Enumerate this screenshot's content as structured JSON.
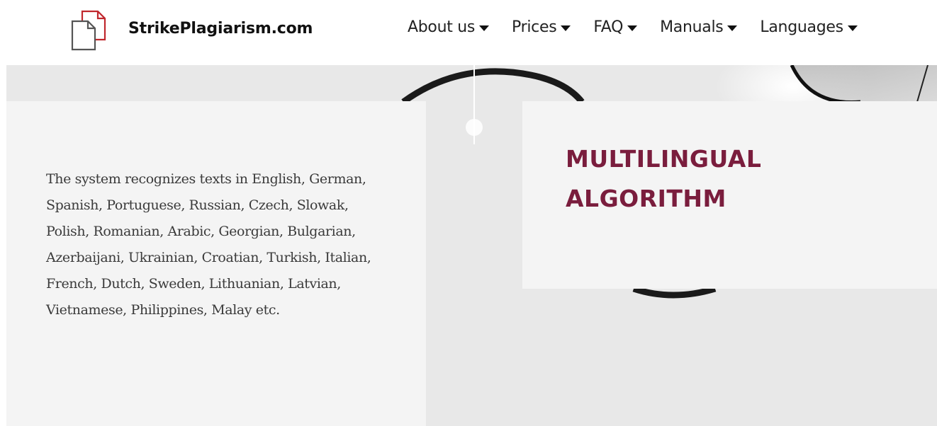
{
  "header": {
    "brand": "StrikePlagiarism.com",
    "logo_icon": "document-icon",
    "nav": [
      {
        "label": "About us",
        "icon": "caret-down-icon"
      },
      {
        "label": "Prices",
        "icon": "caret-down-icon"
      },
      {
        "label": "FAQ",
        "icon": "caret-down-icon"
      },
      {
        "label": "Manuals",
        "icon": "caret-down-icon"
      },
      {
        "label": "Languages",
        "icon": "caret-down-icon"
      }
    ]
  },
  "hero": {
    "description": "The system recognizes texts in English, German, Spanish, Portuguese, Russian, Czech, Slowak, Polish, Romanian, Arabic, Georgian, Bulgarian, Azerbaijani, Ukrainian, Croatian, Turkish, Italian, French, Dutch, Sweden, Lithuanian, Latvian, Vietnamese, Philippines, Malay etc.",
    "title_line1": "MULTILINGUAL",
    "title_line2": "ALGORITHM"
  },
  "colors": {
    "title": "#7a1d3d",
    "logo_accent": "#c0272d",
    "panel": "#f4f4f4",
    "hero_bg": "#e8e8e8"
  }
}
